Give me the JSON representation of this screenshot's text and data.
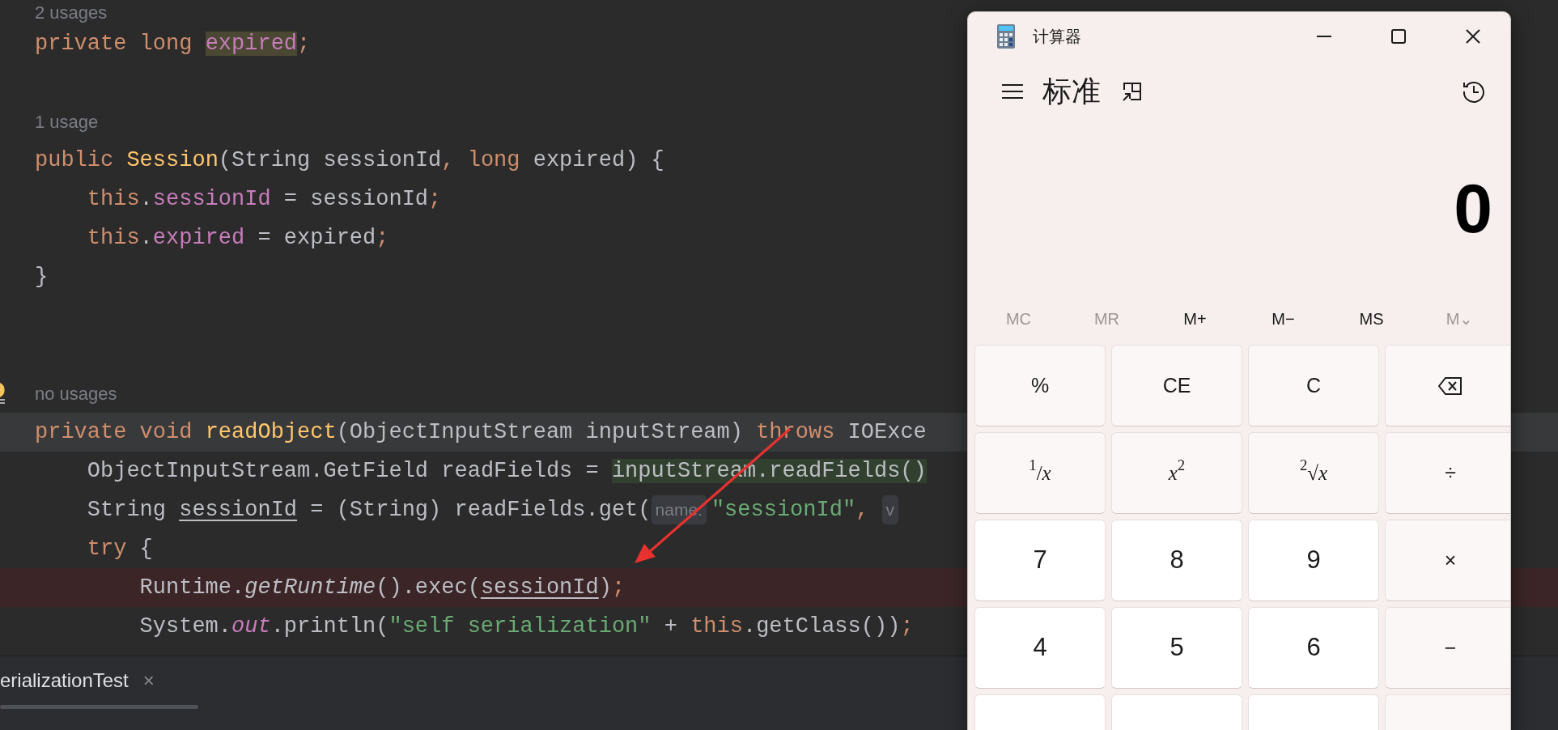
{
  "editor": {
    "lines": [
      {
        "kind": "usages",
        "text": "2 usages"
      },
      {
        "kind": "code",
        "current": false,
        "highlighted": false,
        "tokens": [
          {
            "text": "private long ",
            "kind": "keyword"
          },
          {
            "text": "expired",
            "kind": "field_usage"
          },
          {
            "text": ";",
            "kind": "punct"
          }
        ]
      },
      {
        "kind": "blank"
      },
      {
        "kind": "usages",
        "text": "1 usage"
      },
      {
        "kind": "code",
        "current": false,
        "highlighted": false,
        "tokens": [
          {
            "text": "public ",
            "kind": "keyword"
          },
          {
            "text": "Session",
            "kind": "decl"
          },
          {
            "text": "(String sessionId",
            "kind": "plain"
          },
          {
            "text": ", ",
            "kind": "punct"
          },
          {
            "text": "long ",
            "kind": "keyword"
          },
          {
            "text": "expired) {",
            "kind": "plain"
          }
        ],
        "children": [
          {
            "kind": "code",
            "current": false,
            "highlighted": false,
            "tokens": [
              {
                "text": "this",
                "kind": "keyword"
              },
              {
                "text": ".",
                "kind": "plain"
              },
              {
                "text": "sessionId",
                "kind": "field"
              },
              {
                "text": " = sessionId",
                "kind": "plain"
              },
              {
                "text": ";",
                "kind": "punct"
              }
            ]
          },
          {
            "kind": "code",
            "current": false,
            "highlighted": false,
            "tokens": [
              {
                "text": "this",
                "kind": "keyword"
              },
              {
                "text": ".",
                "kind": "plain"
              },
              {
                "text": "expired",
                "kind": "field"
              },
              {
                "text": " = expired",
                "kind": "plain"
              },
              {
                "text": ";",
                "kind": "punct"
              }
            ]
          }
        ]
      },
      {
        "kind": "code",
        "current": false,
        "highlighted": false,
        "tokens": [
          {
            "text": "}",
            "kind": "plain"
          }
        ]
      },
      {
        "kind": "blank"
      },
      {
        "kind": "blank"
      },
      {
        "kind": "usages",
        "text": "no usages",
        "bulb": true
      },
      {
        "kind": "code",
        "current": true,
        "highlighted": false,
        "tokens": [
          {
            "text": "private void ",
            "kind": "keyword"
          },
          {
            "text": "readObject",
            "kind": "decl"
          },
          {
            "text": "(ObjectInputStream inputStream) ",
            "kind": "plain"
          },
          {
            "text": "throws ",
            "kind": "keyword"
          },
          {
            "text": "IOExce",
            "kind": "plain"
          }
        ],
        "children": [
          {
            "kind": "code",
            "current": false,
            "highlighted": false,
            "tokens": [
              {
                "text": "ObjectInputStream.GetField readFields = ",
                "kind": "plain"
              },
              {
                "text": "inputStream.readFields()",
                "kind": "extracted"
              }
            ]
          },
          {
            "kind": "code",
            "current": false,
            "highlighted": false,
            "tokens": [
              {
                "text": "String ",
                "kind": "plain"
              },
              {
                "text": "sessionId",
                "kind": "underlined"
              },
              {
                "text": " = (String) readFields.get(",
                "kind": "plain"
              },
              {
                "text": "name:",
                "kind": "hint"
              },
              {
                "text": "\"sessionId\"",
                "kind": "string"
              },
              {
                "text": ", ",
                "kind": "punct"
              },
              {
                "text": "v",
                "kind": "hint"
              }
            ]
          },
          {
            "kind": "code",
            "current": false,
            "highlighted": false,
            "tokens": [
              {
                "text": "try",
                "kind": "keyword"
              },
              {
                "text": " {",
                "kind": "plain"
              }
            ],
            "children": [
              {
                "kind": "code",
                "current": false,
                "highlighted": true,
                "tokens": [
                  {
                    "text": "Runtime.",
                    "kind": "plain"
                  },
                  {
                    "text": "getRuntime",
                    "kind": "static_method"
                  },
                  {
                    "text": "().exec(",
                    "kind": "plain"
                  },
                  {
                    "text": "sessionId",
                    "kind": "underlined"
                  },
                  {
                    "text": ")",
                    "kind": "plain"
                  },
                  {
                    "text": ";",
                    "kind": "punct"
                  }
                ]
              },
              {
                "kind": "code",
                "current": false,
                "highlighted": false,
                "tokens": [
                  {
                    "text": "System.",
                    "kind": "plain"
                  },
                  {
                    "text": "out",
                    "kind": "static_field"
                  },
                  {
                    "text": ".println(",
                    "kind": "plain"
                  },
                  {
                    "text": "\"self serialization\"",
                    "kind": "string"
                  },
                  {
                    "text": " + ",
                    "kind": "plain"
                  },
                  {
                    "text": "this",
                    "kind": "keyword"
                  },
                  {
                    "text": ".getClass())",
                    "kind": "plain"
                  },
                  {
                    "text": ";",
                    "kind": "punct"
                  }
                ]
              }
            ]
          }
        ]
      }
    ]
  },
  "bottom_panel": {
    "tab": {
      "label": "erializationTest",
      "close": "×"
    }
  },
  "calculator": {
    "title": "计算器",
    "mode": "标准",
    "display": "0",
    "memory": [
      {
        "label": "MC",
        "disabled": true
      },
      {
        "label": "MR",
        "disabled": true
      },
      {
        "label": "M+",
        "disabled": false
      },
      {
        "label": "M−",
        "disabled": false
      },
      {
        "label": "MS",
        "disabled": false
      },
      {
        "label": "M⌄",
        "disabled": true
      }
    ],
    "keys": [
      {
        "label": "%",
        "kind": "function"
      },
      {
        "label": "CE",
        "kind": "function"
      },
      {
        "label": "C",
        "kind": "function"
      },
      {
        "kind": "backspace"
      },
      {
        "label": "$^{1}$/*x*",
        "kind": "function"
      },
      {
        "label": "*x*$^{2}$",
        "kind": "function"
      },
      {
        "label": "$^{2}$√*x*",
        "kind": "function"
      },
      {
        "label": "÷",
        "kind": "function"
      },
      {
        "label": "7",
        "kind": "digit"
      },
      {
        "label": "8",
        "kind": "digit"
      },
      {
        "label": "9",
        "kind": "digit"
      },
      {
        "label": "×",
        "kind": "function"
      },
      {
        "label": "4",
        "kind": "digit"
      },
      {
        "label": "5",
        "kind": "digit"
      },
      {
        "label": "6",
        "kind": "digit"
      },
      {
        "label": "−",
        "kind": "function"
      },
      {
        "kind": "digit"
      },
      {
        "kind": "digit"
      },
      {
        "kind": "digit"
      },
      {
        "kind": "function"
      }
    ]
  }
}
